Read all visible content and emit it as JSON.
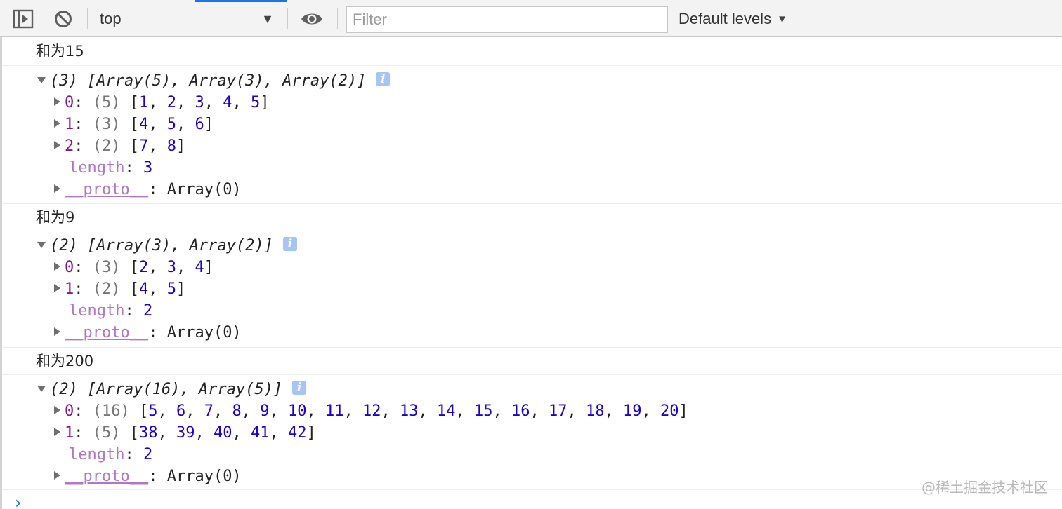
{
  "toolbar": {
    "context": "top",
    "filter_placeholder": "Filter",
    "levels_label": "Default levels",
    "caret": "▼"
  },
  "groups": [
    {
      "label": "和为15",
      "header": "(3) [Array(5), Array(3), Array(2)]",
      "items": [
        {
          "index": "0",
          "count": "(5)",
          "values": [
            "1",
            "2",
            "3",
            "4",
            "5"
          ]
        },
        {
          "index": "1",
          "count": "(3)",
          "values": [
            "4",
            "5",
            "6"
          ]
        },
        {
          "index": "2",
          "count": "(2)",
          "values": [
            "7",
            "8"
          ]
        }
      ],
      "length": "3",
      "proto": "Array(0)"
    },
    {
      "label": "和为9",
      "header": "(2) [Array(3), Array(2)]",
      "items": [
        {
          "index": "0",
          "count": "(3)",
          "values": [
            "2",
            "3",
            "4"
          ]
        },
        {
          "index": "1",
          "count": "(2)",
          "values": [
            "4",
            "5"
          ]
        }
      ],
      "length": "2",
      "proto": "Array(0)"
    },
    {
      "label": "和为200",
      "header": "(2) [Array(16), Array(5)]",
      "items": [
        {
          "index": "0",
          "count": "(16)",
          "values": [
            "5",
            "6",
            "7",
            "8",
            "9",
            "10",
            "11",
            "12",
            "13",
            "14",
            "15",
            "16",
            "17",
            "18",
            "19",
            "20"
          ]
        },
        {
          "index": "1",
          "count": "(5)",
          "values": [
            "38",
            "39",
            "40",
            "41",
            "42"
          ]
        }
      ],
      "length": "2",
      "proto": "Array(0)"
    }
  ],
  "labels": {
    "length_key": "length",
    "proto_key": "__proto__",
    "info": "i"
  },
  "prompt": "›",
  "watermark": "@稀土掘金技术社区",
  "colors": {
    "key": "#881391",
    "number": "#1c00cf",
    "meta_key": "#b078c2",
    "info_badge": "#a6c5f6",
    "prompt": "#1a73e8"
  }
}
